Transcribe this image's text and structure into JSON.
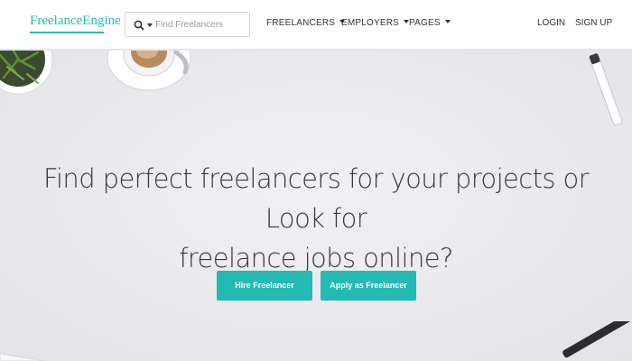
{
  "header": {
    "logo": "FreelanceEngine",
    "search": {
      "placeholder": "Find Freelancers"
    },
    "nav": [
      {
        "label": "FREELANCERS"
      },
      {
        "label": "EMPLOYERS"
      },
      {
        "label": "PAGES"
      }
    ],
    "login": "LOGIN",
    "signup": "SIGN UP"
  },
  "hero": {
    "line1": "Find perfect freelancers for your projects or Look for",
    "line2": "freelance jobs online?",
    "hire_label": "Hire Freelancer",
    "apply_label": "Apply as Freelancer"
  },
  "colors": {
    "accent": "#2ab8b0",
    "button": "#23bab3",
    "background": "#e9e9ed"
  }
}
